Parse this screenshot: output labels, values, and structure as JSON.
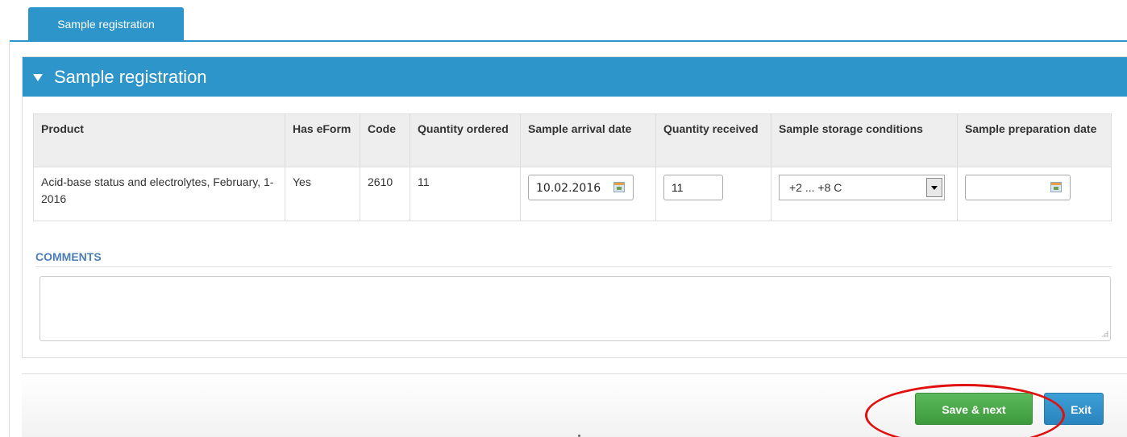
{
  "tabs": [
    {
      "label": "Sample registration"
    }
  ],
  "panel": {
    "title": "Sample registration"
  },
  "table": {
    "headers": {
      "product": "Product",
      "has_eform": "Has eForm",
      "code": "Code",
      "quantity_ordered": "Quantity ordered",
      "arrival_date": "Sample arrival date",
      "quantity_received": "Quantity received",
      "storage_conditions": "Sample storage conditions",
      "preparation_date": "Sample preparation date"
    },
    "rows": [
      {
        "product": "Acid-base status and electrolytes, February, 1-2016",
        "has_eform": "Yes",
        "code": "2610",
        "quantity_ordered": "11",
        "arrival_date": "10.02.2016",
        "quantity_received": "11",
        "storage_conditions": "+2 ... +8 C",
        "preparation_date": ""
      }
    ]
  },
  "comments": {
    "label": "COMMENTS",
    "value": ""
  },
  "footer": {
    "save_label": "Save & next",
    "exit_label": "Exit"
  },
  "colors": {
    "primary_blue": "#2d95ca",
    "save_green": "#5cb85c",
    "annotation_red": "#e01010"
  }
}
